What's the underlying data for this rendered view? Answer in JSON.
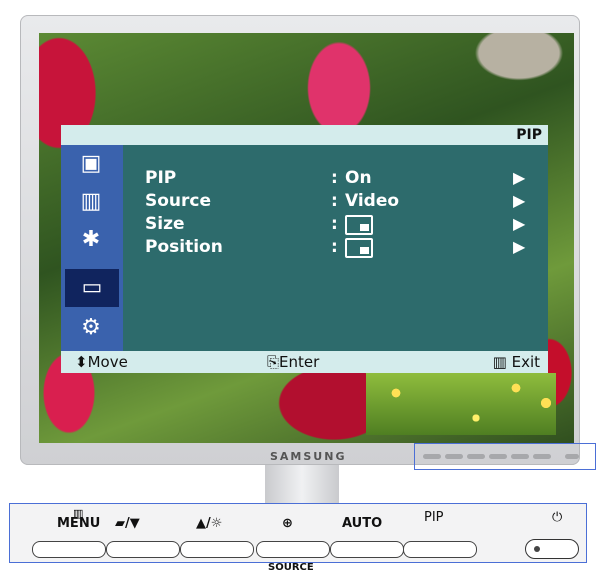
{
  "osd": {
    "title": "PIP",
    "sidebar_icons": [
      "picture-icon",
      "color-icon",
      "image-icon",
      "pip-icon",
      "setup-icon"
    ],
    "rows": [
      {
        "label": "PIP",
        "value": "On"
      },
      {
        "label": "Source",
        "value": "Video"
      },
      {
        "label": "Size",
        "value": ""
      },
      {
        "label": "Position",
        "value": ""
      }
    ],
    "footer": {
      "move": "Move",
      "enter": "Enter",
      "exit": "Exit"
    }
  },
  "monitor": {
    "brand": "SAMSUNG"
  },
  "panel": {
    "menu": "MENU",
    "brightness": "▲/☼",
    "auto": "AUTO",
    "pip": "PIP",
    "source": "SOURCE",
    "power_symbol": "⏻",
    "magic": "/▼"
  }
}
